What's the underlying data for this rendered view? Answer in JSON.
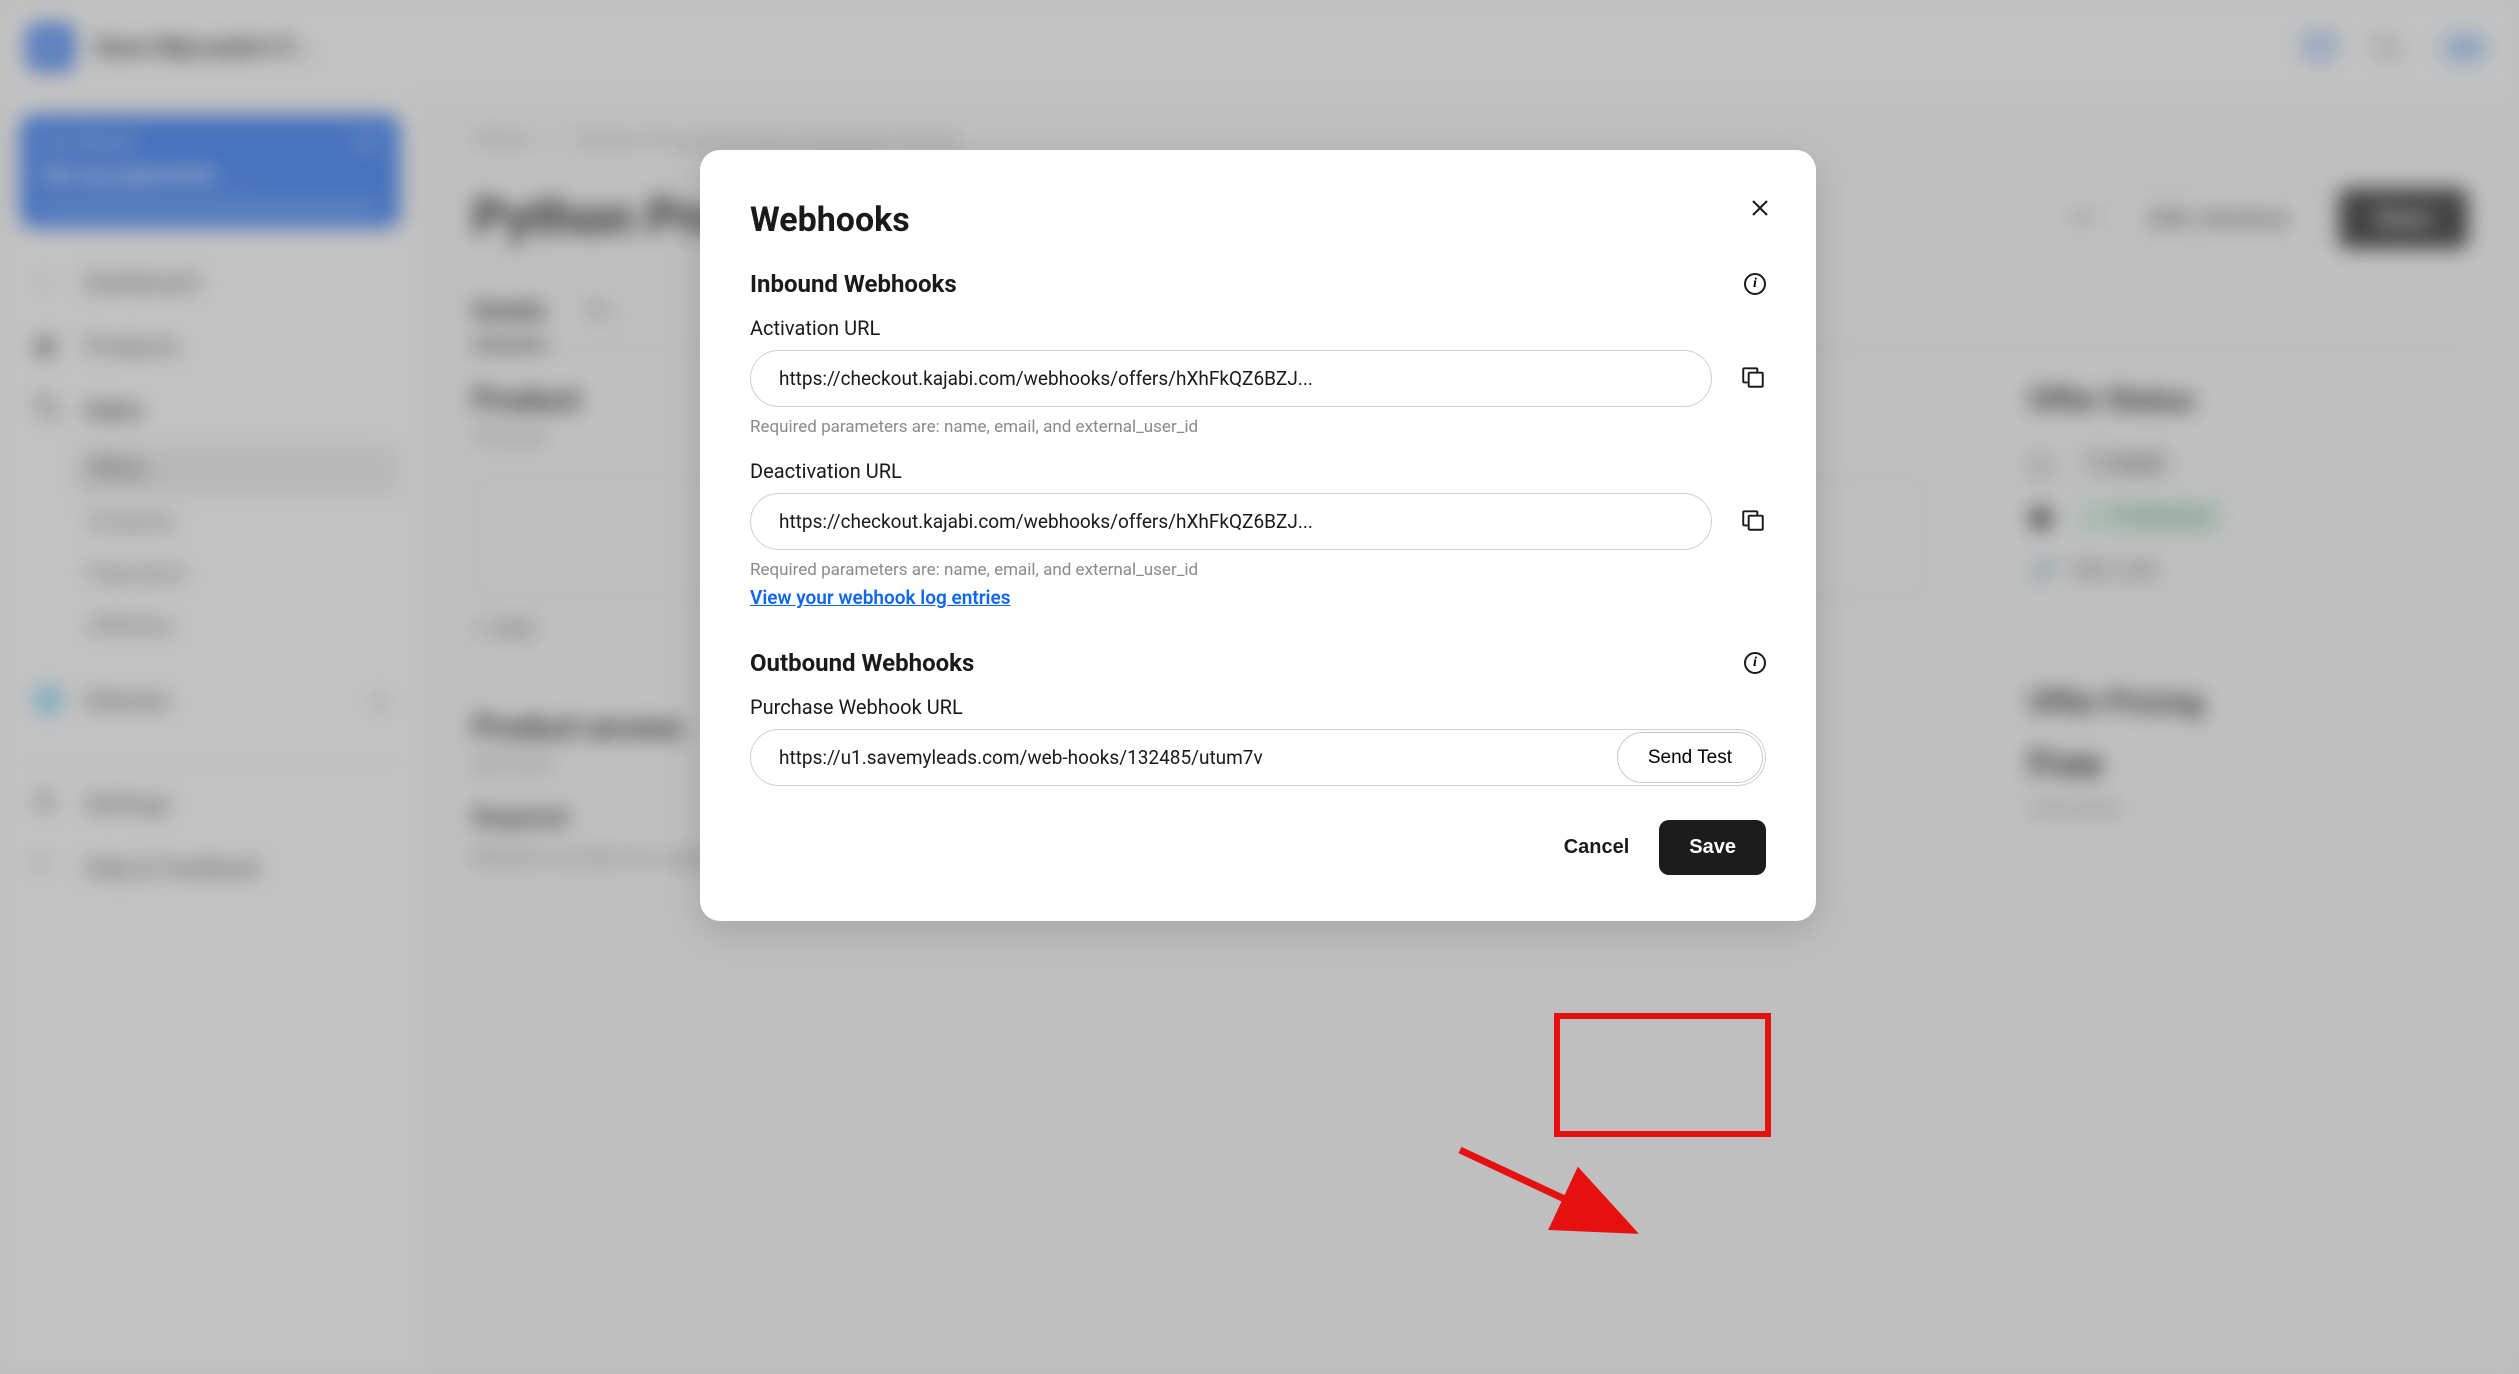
{
  "topbar": {
    "site_name": "Save MyLeads's F...",
    "avatar": "SM"
  },
  "sidebar": {
    "get_started": {
      "label": "Get Started",
      "count": "3/4",
      "action": "Set up payments"
    },
    "items": [
      {
        "label": "Dashboard"
      },
      {
        "label": "Products"
      },
      {
        "label": "Sales"
      },
      {
        "label": "Website"
      },
      {
        "label": "Settings"
      },
      {
        "label": "Help & Feedback"
      }
    ],
    "sales_sub": [
      {
        "label": "Offers"
      },
      {
        "label": "Coupons"
      },
      {
        "label": "Payments"
      },
      {
        "label": "Affiliates"
      }
    ]
  },
  "breadcrumb": {
    "a": "Offers",
    "sep": "/",
    "b": "Python Programming Language Course"
  },
  "page": {
    "title": "Python Programming Language Course",
    "edit_checkout": "Edit checkout",
    "save": "Save"
  },
  "tabs": [
    {
      "label": "Details"
    },
    {
      "label": "Pr..."
    }
  ],
  "left": {
    "prod_title": "Product",
    "prod_sub": "Choose",
    "add": "+  Add",
    "pa_title": "Product access",
    "pa_sub": "Set limit",
    "req": "Required",
    "restrict": "Restrict access to a specific amount of days"
  },
  "right": {
    "status_title": "Offer Status",
    "draft": "Draft",
    "published": "Published",
    "get_link": "Get Link",
    "pricing_title": "Offer Pricing",
    "free": "Free",
    "unlocked": "Unlocked"
  },
  "modal": {
    "title": "Webhooks",
    "inbound_title": "Inbound Webhooks",
    "activation_label": "Activation URL",
    "activation_value": "https://checkout.kajabi.com/webhooks/offers/hXhFkQZ6BZJ...",
    "activation_hint": "Required parameters are: name, email, and external_user_id",
    "deactivation_label": "Deactivation URL",
    "deactivation_value": "https://checkout.kajabi.com/webhooks/offers/hXhFkQZ6BZJ...",
    "deactivation_hint": "Required parameters are: name, email, and external_user_id",
    "log_link": "View your webhook log entries",
    "outbound_title": "Outbound Webhooks",
    "purchase_label": "Purchase Webhook URL",
    "purchase_value": "https://u1.savemyleads.com/web-hooks/132485/utum7v",
    "send_test": "Send Test",
    "cancel": "Cancel",
    "save": "Save"
  }
}
